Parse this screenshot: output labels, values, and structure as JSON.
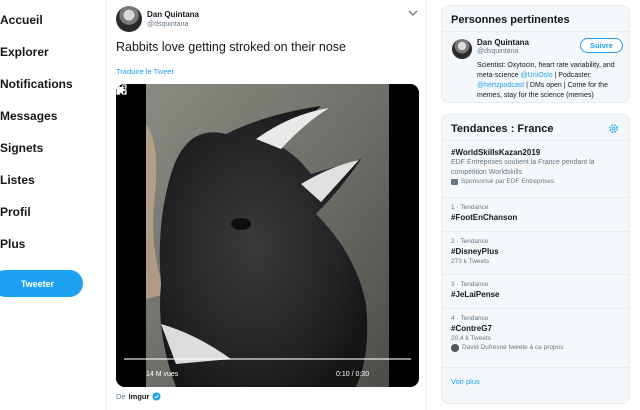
{
  "nav": {
    "items": [
      {
        "label": "Accueil"
      },
      {
        "label": "Explorer"
      },
      {
        "label": "Notifications"
      },
      {
        "label": "Messages"
      },
      {
        "label": "Signets"
      },
      {
        "label": "Listes"
      },
      {
        "label": "Profil"
      },
      {
        "label": "Plus"
      }
    ],
    "tweet_button": "Tweeter"
  },
  "tweet": {
    "author_name": "Dan Quintana",
    "author_handle": "@dsquintana",
    "text": "Rabbits love getting stroked on their nose",
    "translate_label": "Traduire le Tweet",
    "video": {
      "views": "14 M vues",
      "time": "0:10 / 0:30"
    },
    "source_prefix": "De",
    "source_name": "Imgur"
  },
  "people": {
    "title": "Personnes pertinentes",
    "person": {
      "name": "Dan Quintana",
      "handle": "@dsquintana",
      "follow_label": "Suivre",
      "bio_part1": "Scientist: Oxytocin, heart rate variability, and meta-science ",
      "bio_link1": "@UniOslo",
      "bio_part2": " | Podcaster: ",
      "bio_link2": "@hertzpodcast",
      "bio_part3": " | DMs open | Come for the memes, stay for the science (memes)"
    }
  },
  "trends": {
    "title": "Tendances : France",
    "items": [
      {
        "name": "#WorldSkillsKazan2019",
        "desc": "EDF Entreprises soutient la France pendant la compétition Worldskills",
        "sub": "Sponsorisé par EDF Entreprises"
      },
      {
        "meta": "1 · Tendance",
        "name": "#FootEnChanson"
      },
      {
        "meta": "2 · Tendance",
        "name": "#DisneyPlus",
        "sub": "273 k Tweets"
      },
      {
        "meta": "3 · Tendance",
        "name": "#JeLaiPense"
      },
      {
        "meta": "4 · Tendance",
        "name": "#ContreG7",
        "sub": "20,4 k Tweets",
        "sub2": "David Dufresne tweete à ce propos"
      }
    ],
    "see_more": "Voir plus"
  },
  "colors": {
    "accent": "#1da1f2",
    "text": "#14171a",
    "muted": "#657786",
    "border": "#e6ecf0",
    "panel_bg": "#f5f8fa"
  }
}
